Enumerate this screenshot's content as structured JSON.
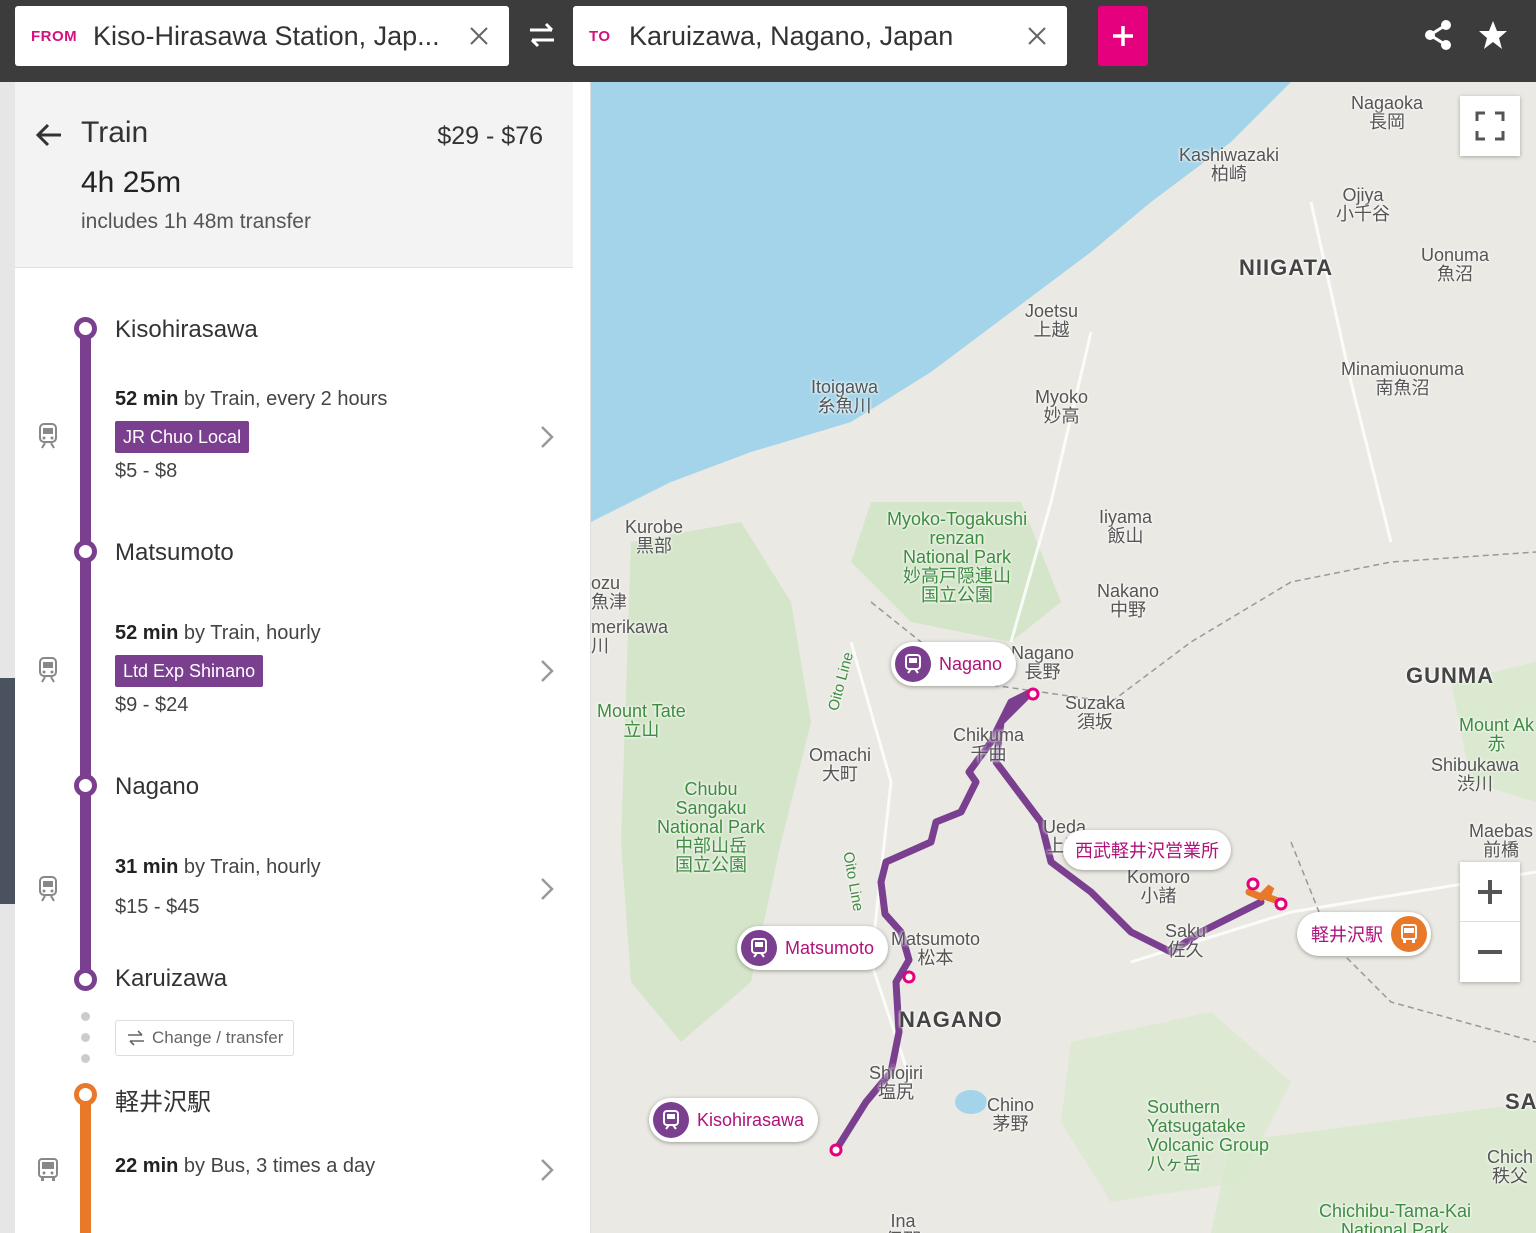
{
  "search": {
    "from_tag": "FROM",
    "from_value": "Kiso-Hirasawa Station, Jap...",
    "to_tag": "TO",
    "to_value": "Karuizawa, Nagano, Japan"
  },
  "route": {
    "mode": "Train",
    "price_range": "$29 - $76",
    "duration": "4h 25m",
    "transfer_note": "includes 1h 48m transfer"
  },
  "stops": [
    {
      "name": "Kisohirasawa"
    },
    {
      "name": "Matsumoto"
    },
    {
      "name": "Nagano"
    },
    {
      "name": "Karuizawa"
    },
    {
      "name": "軽井沢駅"
    }
  ],
  "legs": [
    {
      "minutes": "52 min",
      "desc": " by Train, every 2 hours",
      "badge": "JR Chuo Local",
      "price": "$5 - $8",
      "vehicle_icon": "train-icon"
    },
    {
      "minutes": "52 min",
      "desc": " by Train, hourly",
      "badge": "Ltd Exp Shinano",
      "price": "$9 - $24",
      "vehicle_icon": "train-icon"
    },
    {
      "minutes": "31 min",
      "desc": " by Train, hourly",
      "price": "$15 - $45",
      "vehicle_icon": "train-icon"
    },
    {
      "minutes": "22 min",
      "desc": " by Bus, 3 times a day",
      "vehicle_icon": "bus-icon"
    }
  ],
  "change_label": "Change / transfer",
  "map": {
    "pins": {
      "nagano": "Nagano",
      "matsumoto": "Matsumoto",
      "kisohirasawa": "Kisohirasawa",
      "seibu": "西武軽井沢営業所",
      "karuizawa_station": "軽井沢駅"
    },
    "labels": {
      "nagaoka": "Nagaoka\n長岡",
      "kashiwazaki": "Kashiwazaki\n柏崎",
      "ojiya": "Ojiya\n小千谷",
      "niigata": "NIIGATA",
      "uonuma": "Uonuma\n魚沼",
      "joetsu": "Joetsu\n上越",
      "minamiuonuma": "Minamiuonuma\n南魚沼",
      "itoigawa": "Itoigawa\n糸魚川",
      "myoko": "Myoko\n妙高",
      "kurobe": "Kurobe\n黒部",
      "myoko_park": "Myoko-Togakushi\nrenzan\nNational Park\n妙高戸隠連山\n国立公園",
      "iiyama": "Iiyama\n飯山",
      "nakano": "Nakano\n中野",
      "uozu": "ozu\n魚津",
      "namerikawa": "merikawa\n川",
      "nagano_city": "Nagano\n長野",
      "suzaka": "Suzaka\n須坂",
      "gunma": "GUNMA",
      "mount_tate": "Mount Tate\n立山",
      "mount_akagi": "Mount Ak\n赤",
      "omachi": "Omachi\n大町",
      "chikuma": "Chikuma\n千曲",
      "shibukawa": "Shibukawa\n渋川",
      "chubu_park": "Chubu\nSangaku\nNational Park\n中部山岳\n国立公園",
      "ueda": "Ueda\n上田",
      "maebashi": "Maebas\n前橋",
      "komoro": "Komoro\n小諸",
      "saku": "Saku\n佐久",
      "matsumoto_city": "Matsumoto\n松本",
      "nagano_pref": "NAGANO",
      "shiojiri": "Shiojiri\n塩尻",
      "chino": "Chino\n茅野",
      "yatsugatake": "Southern\nYatsugatake\nVolcanic Group\n八ヶ岳",
      "saitama": "SA",
      "chichibu": "Chich\n秩父",
      "chichibu_park": "Chichibu-Tama-Kai\nNational Park",
      "ina": "Ina\n伊那",
      "oito1": "Oito Line",
      "oito2": "Oito Line"
    }
  },
  "colors": {
    "accent": "#e5007d",
    "train_line": "#7a3f8f",
    "bus_line": "#e8792b",
    "water": "#a3d4ea"
  }
}
